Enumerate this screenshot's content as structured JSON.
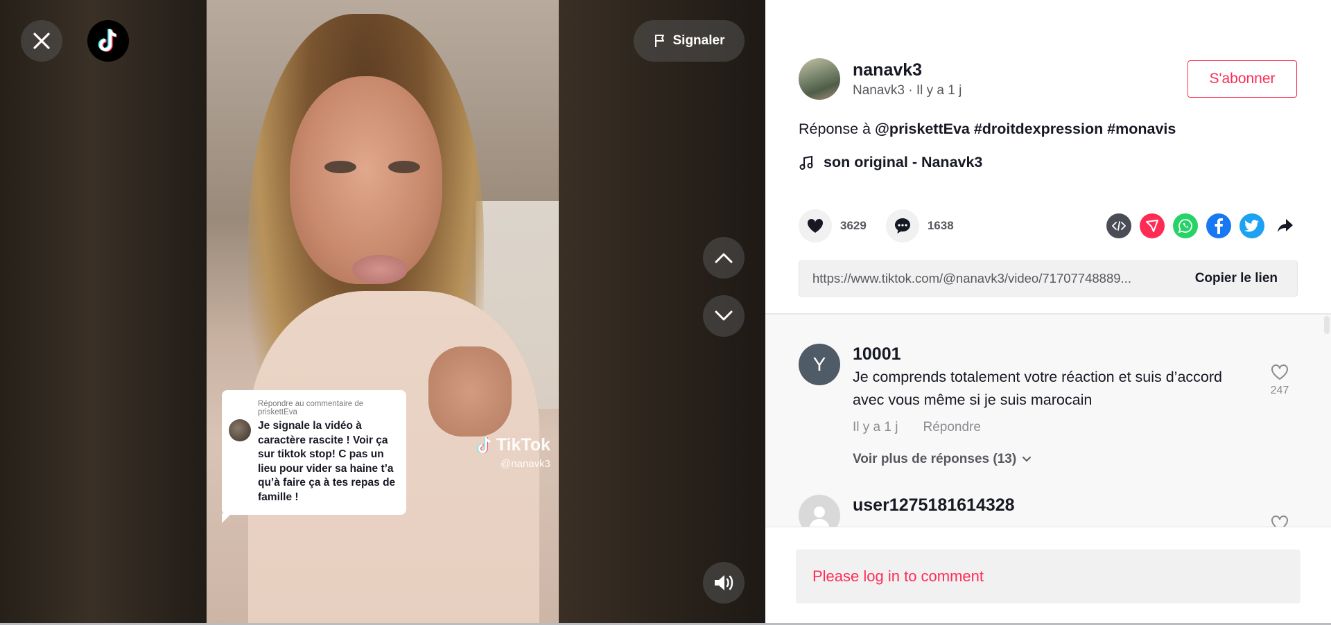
{
  "video": {
    "report_label": "Signaler",
    "reply_card": {
      "header": "Répondre au commentaire de priskettEva",
      "text": "Je signale la vidéo à caractère rascite ! Voir ça sur tiktok stop! C pas un lieu pour vider sa haine t’a qu’à faire ça à tes repas de famille !"
    },
    "watermark": {
      "brand": "TikTok",
      "user": "@nanavk3"
    }
  },
  "post": {
    "author_name": "nanavk3",
    "author_subline": "Nanavk3 · Il y a 1 j",
    "follow_label": "S'abonner",
    "desc_prefix": "Réponse à ",
    "desc_tags": "@priskettEva #droitdexpression #monavis",
    "music": "son original - Nanavk3",
    "likes": "3629",
    "comments_count": "1638",
    "link": "https://www.tiktok.com/@nanavk3/video/71707748889...",
    "copy_label": "Copier le lien"
  },
  "comments": [
    {
      "avatar_letter": "Y",
      "name": "10001",
      "text": "Je comprends totalement votre réaction et suis d’accord avec vous même si je suis marocain",
      "time": "Il y a 1 j",
      "reply_label": "Répondre",
      "likes": "247",
      "more_replies": "Voir plus de réponses (13)"
    },
    {
      "name": "user1275181614328"
    }
  ],
  "login_prompt": "Please log in to comment",
  "colors": {
    "accent": "#fe2c55",
    "whatsapp": "#25d366",
    "facebook": "#1877f2",
    "twitter": "#1da1f2",
    "embed": "#4a4d56"
  },
  "icons": [
    "close-icon",
    "tiktok-logo-icon",
    "flag-icon",
    "chevron-up-icon",
    "chevron-down-icon",
    "speaker-icon",
    "music-note-icon",
    "heart-icon",
    "comment-icon",
    "embed-icon",
    "send-icon",
    "whatsapp-icon",
    "facebook-icon",
    "twitter-icon",
    "share-arrow-icon"
  ]
}
